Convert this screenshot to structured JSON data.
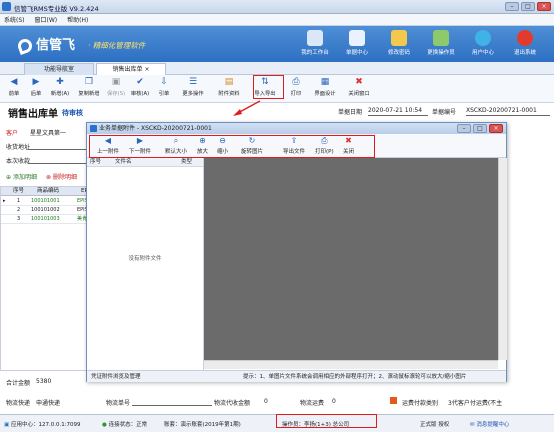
{
  "window": {
    "title": "信管飞RMS专业版 V9.2.424"
  },
  "menu": [
    "系统(S)",
    "窗口(W)",
    "帮助(H)"
  ],
  "banner": {
    "logo": "信管飞",
    "slogan": "· 精细化管理软件",
    "nav": [
      "我的工作台",
      "单据中心",
      "修改密码",
      "更换操作员",
      "用户中心",
      "退出系统"
    ]
  },
  "tabs": [
    "功能导航室",
    "销售出库单"
  ],
  "toolbar": [
    "前单",
    "后单",
    "新增(A)",
    "复制新增",
    "保存(S)",
    "审核(A)",
    "引单",
    "更多操作",
    "附件资料",
    "导入导出",
    "打印",
    "界面设计",
    "关闭窗口"
  ],
  "doc": {
    "title": "销售出库单",
    "status": "待审核",
    "date_label": "单据日期",
    "date": "2020-07-21 10:54",
    "no_label": "单据编号",
    "no": "XSCKD-20200721-0001"
  },
  "form": {
    "customer_label": "客户",
    "customer": "星星文具第一",
    "address_label": "收货地址",
    "note_label": "本次收款"
  },
  "detail_buttons": [
    "添加明细",
    "删除明细"
  ],
  "grid": {
    "headers": [
      "序号",
      "商品编码",
      "EPIS"
    ],
    "rows": [
      [
        "1",
        "100101001",
        "EPIS"
      ],
      [
        "2",
        "100101002",
        "EPIS"
      ],
      [
        "3",
        "100101003",
        "美肯"
      ]
    ]
  },
  "dialog": {
    "title": "业务单据附件 - XSCKD-20200721-0001",
    "toolbar": [
      "上一附件",
      "下一附件",
      "默认大小",
      "放大",
      "缩小",
      "旋转图片",
      "导出文件",
      "打印(P)",
      "关闭"
    ],
    "list_headers": [
      "序号",
      "文件名",
      "类型"
    ],
    "empty_text": "没有附件文件",
    "footer_left": "凭证附件浏览及管理",
    "footer_tip": "提示：1、单图片文件系统会调用相应的外部程序打开；2、滚动鼠标滚轮可以放大/缩小图片"
  },
  "footer_form": {
    "total_label": "合计金额",
    "total": "5380",
    "express_label": "物流快递",
    "express": "申通快递",
    "track_label": "物流单号",
    "cod_label": "物流代收金额",
    "cod": "0",
    "freight_label": "物流运费",
    "freight": "0",
    "freight_pay_label": "运费付款类别",
    "freight_pay": "3代客户付运费(不主"
  },
  "statusbar": {
    "server": "应用中心：127.0.0.1:7099",
    "conn": "连接状态：正常",
    "account": "账套：演示账套(2019年第1期)",
    "operator": "操作员：李扬(1+3) 总公司",
    "edition": "正式版 授权",
    "feedback": "消息提醒中心"
  },
  "colors": {
    "banner": "#2d6fc2",
    "highlight": "#e01b1b",
    "accent": "#1e54b4"
  }
}
